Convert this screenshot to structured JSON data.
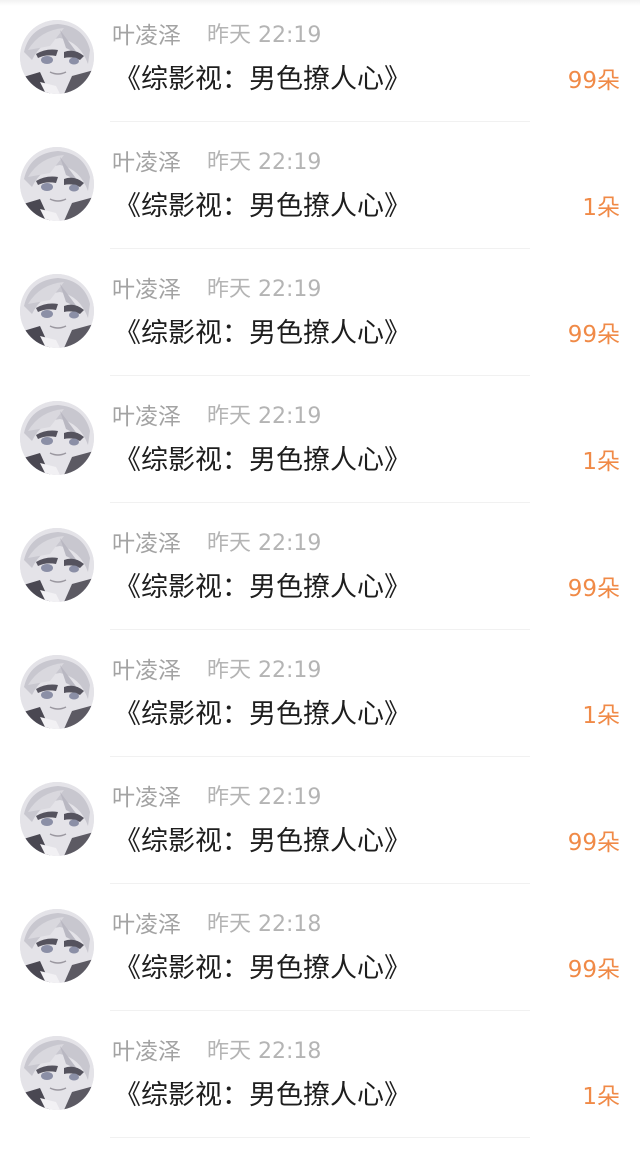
{
  "items": [
    {
      "user": "叶凌泽",
      "time": "昨天 22:19",
      "title": "《综影视：男色撩人心》",
      "count": "99朵"
    },
    {
      "user": "叶凌泽",
      "time": "昨天 22:19",
      "title": "《综影视：男色撩人心》",
      "count": "1朵"
    },
    {
      "user": "叶凌泽",
      "time": "昨天 22:19",
      "title": "《综影视：男色撩人心》",
      "count": "99朵"
    },
    {
      "user": "叶凌泽",
      "time": "昨天 22:19",
      "title": "《综影视：男色撩人心》",
      "count": "1朵"
    },
    {
      "user": "叶凌泽",
      "time": "昨天 22:19",
      "title": "《综影视：男色撩人心》",
      "count": "99朵"
    },
    {
      "user": "叶凌泽",
      "time": "昨天 22:19",
      "title": "《综影视：男色撩人心》",
      "count": "1朵"
    },
    {
      "user": "叶凌泽",
      "time": "昨天 22:19",
      "title": "《综影视：男色撩人心》",
      "count": "99朵"
    },
    {
      "user": "叶凌泽",
      "time": "昨天 22:18",
      "title": "《综影视：男色撩人心》",
      "count": "99朵"
    },
    {
      "user": "叶凌泽",
      "time": "昨天 22:18",
      "title": "《综影视：男色撩人心》",
      "count": "1朵"
    }
  ],
  "colors": {
    "count": "#f08a47",
    "name": "#a3a3a3",
    "time": "#b4b4b4",
    "title": "#1e1e1e"
  },
  "icons": {
    "avatar": "anime-character-avatar-icon"
  }
}
